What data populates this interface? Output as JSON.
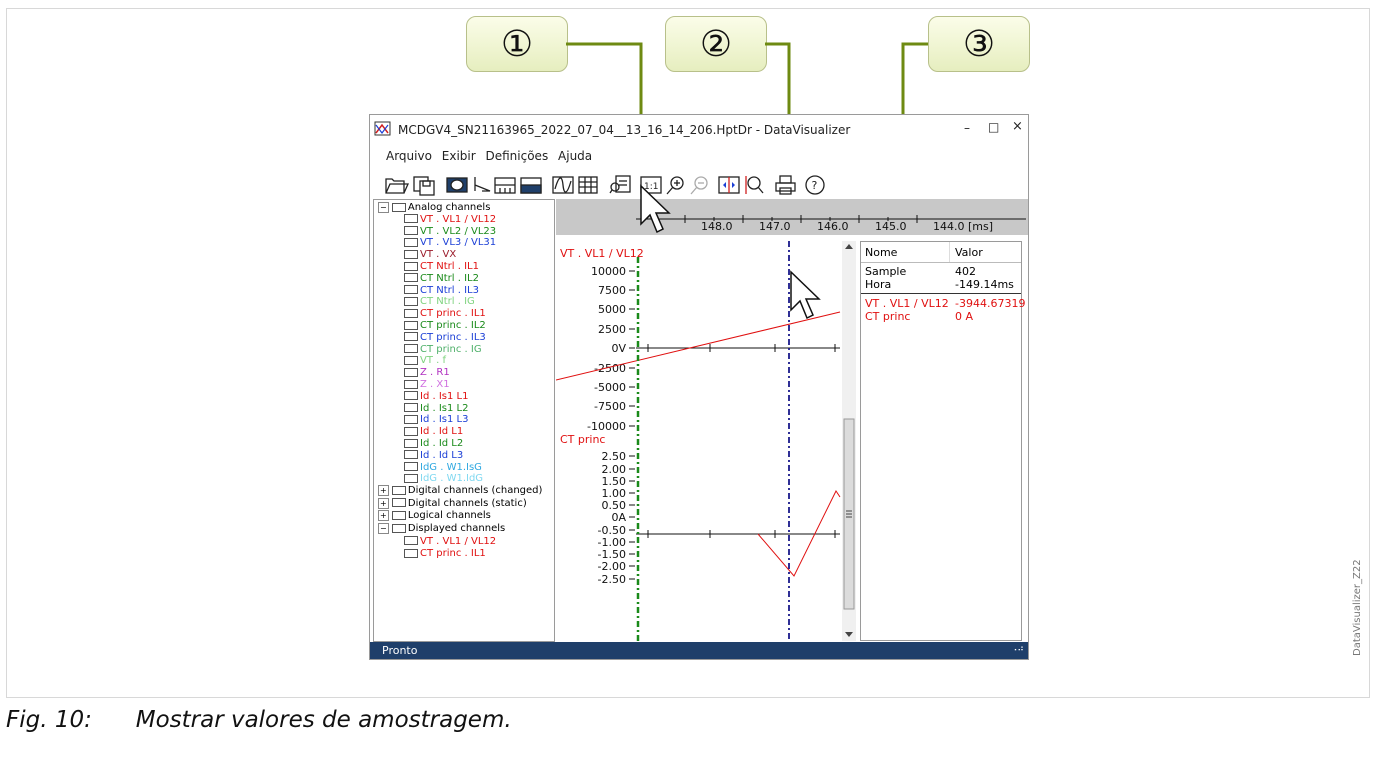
{
  "window": {
    "title": "MCDGV4_SN21163965_2022_07_04__13_16_14_206.HptDr - DataVisualizer",
    "controls": [
      "–",
      "□",
      "×"
    ]
  },
  "menu": [
    "Arquivo",
    "Exibir",
    "Definições",
    "Ajuda"
  ],
  "callouts": [
    "①",
    "②",
    "③"
  ],
  "toolbar_icons": [
    "open-file-icon",
    "save-file-icon",
    "channel-select-icon",
    "cursor-icon",
    "split-view-icon",
    "overlay-view-icon",
    "wave-icon",
    "grid-icon",
    "sample-values-icon",
    "zoom-1-1-icon",
    "zoom-in-icon",
    "zoom-out-icon",
    "trigger-icon",
    "zoom-time-icon",
    "print-icon",
    "help-icon"
  ],
  "timeline": {
    "ticks": [
      "148.0",
      "147.0",
      "146.0",
      "145.0",
      "144.0 [ms]"
    ]
  },
  "tree": {
    "analog_header": "Analog channels",
    "analog": [
      {
        "label": "VT . VL1  / VL12",
        "color": "#e01010"
      },
      {
        "label": "VT . VL2  / VL23",
        "color": "#1a8a1a"
      },
      {
        "label": "VT . VL3  / VL31",
        "color": "#1b3fd6"
      },
      {
        "label": "VT . VX",
        "color": "#9a1a2a"
      },
      {
        "label": "CT Ntrl . IL1",
        "color": "#e01010"
      },
      {
        "label": "CT Ntrl . IL2",
        "color": "#1a8a1a"
      },
      {
        "label": "CT Ntrl . IL3",
        "color": "#1b3fd6"
      },
      {
        "label": "CT Ntrl . IG",
        "color": "#7fd37f"
      },
      {
        "label": "CT princ . IL1",
        "color": "#e01010"
      },
      {
        "label": "CT princ . IL2",
        "color": "#1a8a1a"
      },
      {
        "label": "CT princ . IL3",
        "color": "#1b3fd6"
      },
      {
        "label": "CT princ . IG",
        "color": "#4fb06a"
      },
      {
        "label": "VT . f",
        "color": "#7fd37f"
      },
      {
        "label": "Z . R1",
        "color": "#b030c0"
      },
      {
        "label": "Z . X1",
        "color": "#d070e0"
      },
      {
        "label": "Id . Is1 L1",
        "color": "#e01010"
      },
      {
        "label": "Id . Is1 L2",
        "color": "#1a8a1a"
      },
      {
        "label": "Id . Is1 L3",
        "color": "#1b3fd6"
      },
      {
        "label": "Id . Id L1",
        "color": "#e01010"
      },
      {
        "label": "Id . Id L2",
        "color": "#1a8a1a"
      },
      {
        "label": "Id . Id L3",
        "color": "#1b3fd6"
      },
      {
        "label": "IdG . W1.IsG",
        "color": "#30a8e0"
      },
      {
        "label": "IdG . W1.IdG",
        "color": "#80d8f0"
      }
    ],
    "groups": [
      "Digital channels (changed)",
      "Digital channels (static)",
      "Logical channels",
      "Displayed channels"
    ],
    "displayed": [
      {
        "label": "VT . VL1  / VL12",
        "color": "#e01010"
      },
      {
        "label": "CT princ . IL1",
        "color": "#e01010"
      }
    ]
  },
  "plot1": {
    "label": "VT . VL1  / VL12",
    "ticks": [
      "10000",
      "7500",
      "5000",
      "2500",
      "0V",
      "-2500",
      "-5000",
      "-7500",
      "-10000"
    ]
  },
  "plot2": {
    "label": "CT princ",
    "ticks": [
      "2.50",
      "2.00",
      "1.50",
      "1.00",
      "0.50",
      "0A",
      "-0.50",
      "-1.00",
      "-1.50",
      "-2.00",
      "-2.50"
    ]
  },
  "values_table": {
    "headers": [
      "Nome",
      "Valor"
    ],
    "rows": [
      [
        "Sample",
        "402"
      ],
      [
        "Hora",
        "-149.14ms"
      ]
    ],
    "channel_rows": [
      [
        "VT . VL1  / VL12",
        "-3944.67319"
      ],
      [
        "CT princ",
        "0 A"
      ]
    ]
  },
  "status": "Pronto",
  "caption": "Fig. 10:      Mostrar valores de amostragem.",
  "side_label": "DataVisualizer_Z22"
}
